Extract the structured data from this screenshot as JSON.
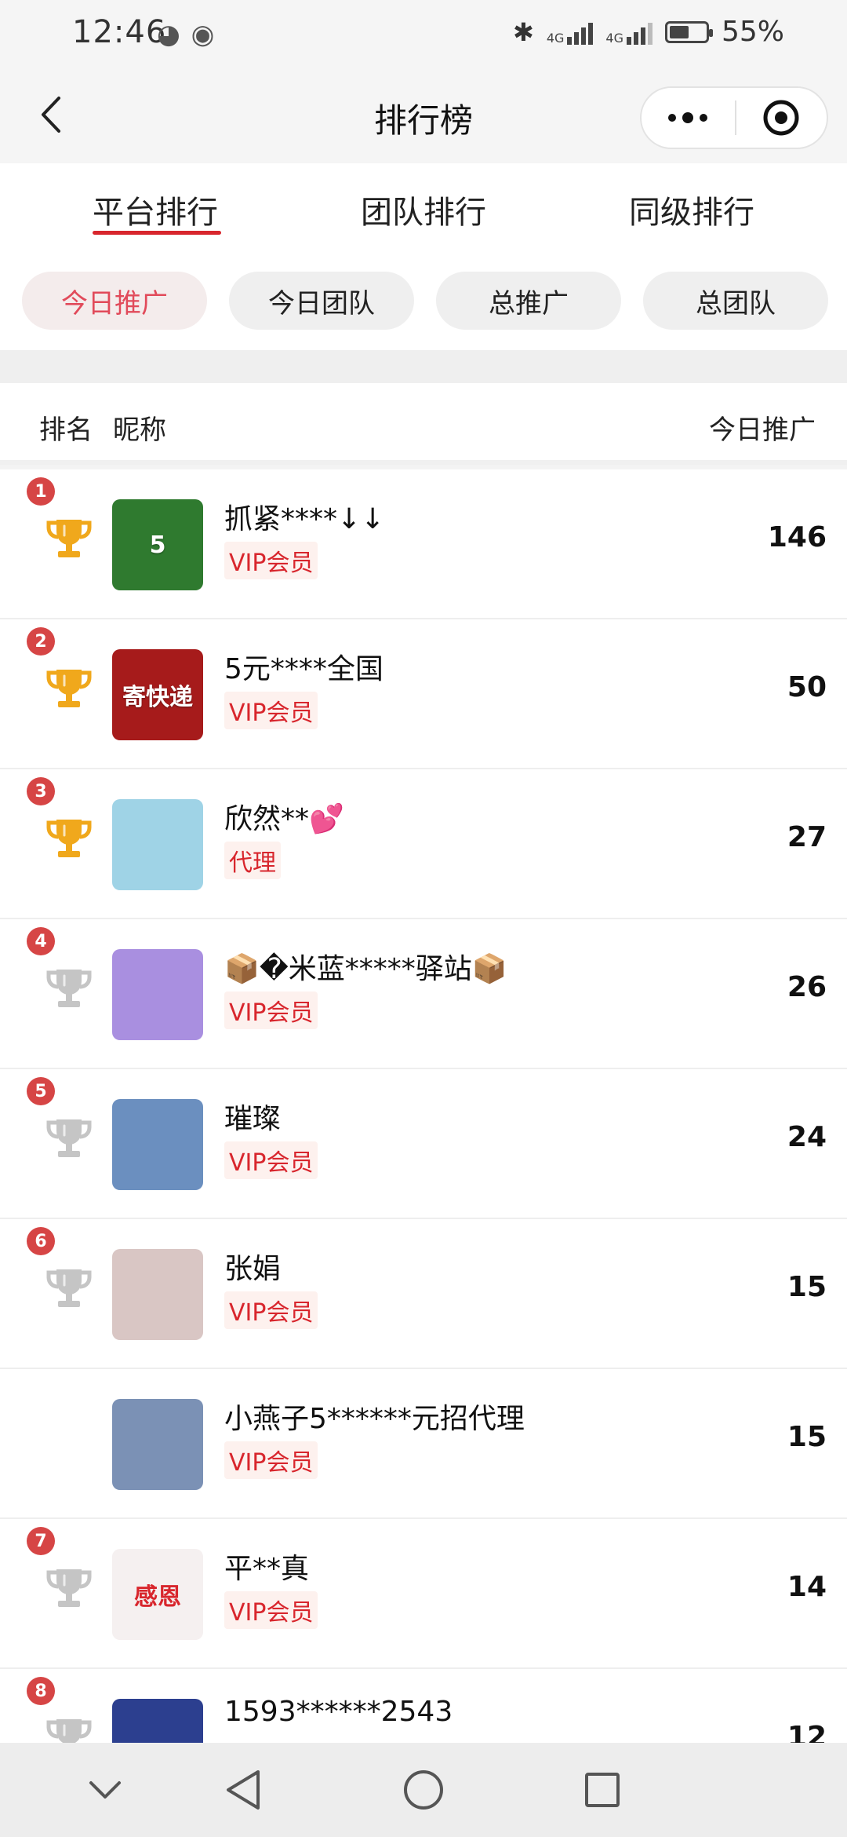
{
  "status_bar": {
    "time": "12:46",
    "network_1": "4G",
    "network_2": "4G",
    "battery": "55%",
    "battery_level": 0.55
  },
  "navbar": {
    "title": "排行榜"
  },
  "tabs": [
    {
      "label": "平台排行",
      "active": true
    },
    {
      "label": "团队排行",
      "active": false
    },
    {
      "label": "同级排行",
      "active": false
    }
  ],
  "filters": [
    {
      "label": "今日推广",
      "active": true
    },
    {
      "label": "今日团队",
      "active": false
    },
    {
      "label": "总推广",
      "active": false
    },
    {
      "label": "总团队",
      "active": false
    }
  ],
  "table_header": {
    "rank": "排名",
    "nickname": "昵称",
    "metric": "今日推广"
  },
  "rows": [
    {
      "rank": "1",
      "trophy": "gold",
      "nickname": "抓紧****↓↓",
      "tag": "VIP会员",
      "score": "146",
      "avatar_color": "#2f7a2f",
      "avatar_text": "5"
    },
    {
      "rank": "2",
      "trophy": "gold",
      "nickname": "5元****全国",
      "tag": "VIP会员",
      "score": "50",
      "avatar_color": "#a61b1b",
      "avatar_text": "寄快递"
    },
    {
      "rank": "3",
      "trophy": "gold",
      "nickname": "欣然**💕",
      "tag": "代理",
      "score": "27",
      "avatar_color": "#9fd3e6",
      "avatar_text": ""
    },
    {
      "rank": "4",
      "trophy": "gray",
      "nickname": "📦�米蓝*****驿站📦",
      "tag": "VIP会员",
      "score": "26",
      "avatar_color": "#a98fe0",
      "avatar_text": ""
    },
    {
      "rank": "5",
      "trophy": "gray",
      "nickname": "璀璨",
      "tag": "VIP会员",
      "score": "24",
      "avatar_color": "#6b8fbf",
      "avatar_text": ""
    },
    {
      "rank": "6",
      "trophy": "gray",
      "nickname": "张娟",
      "tag": "VIP会员",
      "score": "15",
      "avatar_color": "#d9c6c4",
      "avatar_text": ""
    },
    {
      "rank": "",
      "trophy": "none",
      "nickname": "小燕子5******元招代理",
      "tag": "VIP会员",
      "score": "15",
      "avatar_color": "#7b91b5",
      "avatar_text": ""
    },
    {
      "rank": "7",
      "trophy": "gray",
      "nickname": "平**真",
      "tag": "VIP会员",
      "score": "14",
      "avatar_color": "#f5f0f0",
      "avatar_text": "感恩"
    },
    {
      "rank": "8",
      "trophy": "gray",
      "nickname": "1593******2543",
      "tag": "",
      "score": "12",
      "avatar_color": "#2c3f8f",
      "avatar_text": ""
    }
  ],
  "icons": {
    "back": "back-arrow-icon",
    "more": "more-dots-icon",
    "target": "target-icon",
    "nav_back": "triangle-back-icon",
    "nav_home": "circle-home-icon",
    "nav_recent": "square-recent-icon",
    "nav_collapse": "chevron-down-icon"
  },
  "colors": {
    "accent": "#d8262d",
    "active_chip_text": "#e14a5a",
    "trophy_gold": "#f0a81c",
    "trophy_gray": "#c5c5c5",
    "badge": "#d64545"
  }
}
